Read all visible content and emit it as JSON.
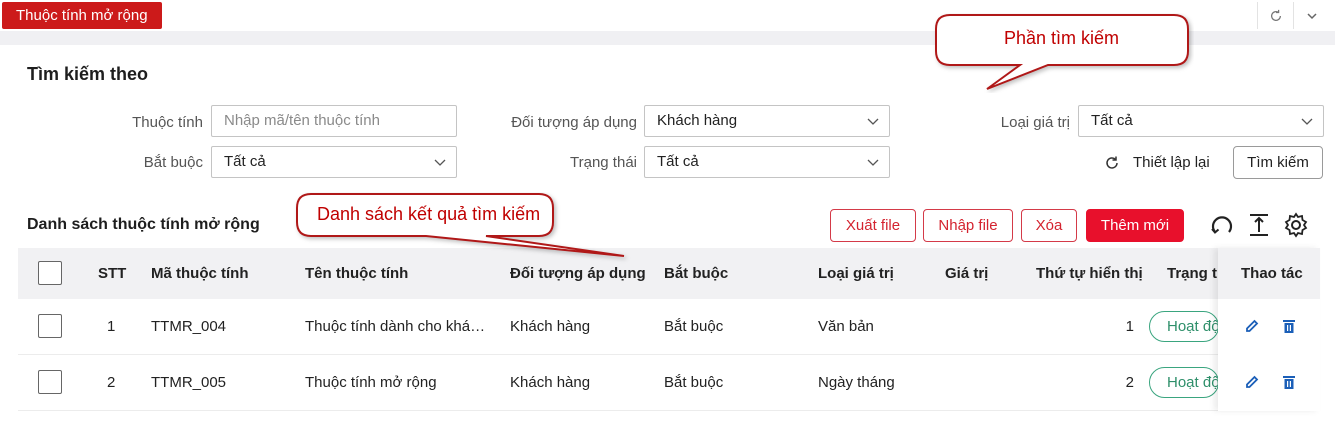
{
  "header": {
    "tab_title": "Thuộc tính mở rộng",
    "actions": [
      {
        "icon": "refresh-icon"
      },
      {
        "icon": "chevron-down-icon"
      }
    ]
  },
  "search": {
    "title": "Tìm kiếm theo",
    "attribute_label": "Thuộc tính",
    "attribute_placeholder": "Nhập mã/tên thuộc tính",
    "target_label": "Đối tượng áp dụng",
    "target_value": "Khách hàng",
    "value_type_label": "Loại giá trị",
    "value_type_value": "Tất cả",
    "required_label": "Bắt buộc",
    "required_value": "Tất cả",
    "status_label": "Trạng thái",
    "status_value": "Tất cả",
    "reset_label": "Thiết lập lại",
    "search_label": "Tìm kiếm"
  },
  "list": {
    "title": "Danh sách thuộc tính mở rộng",
    "export_label": "Xuất file",
    "import_label": "Nhập file",
    "delete_label": "Xóa",
    "add_label": "Thêm mới",
    "columns": [
      "STT",
      "Mã thuộc tính",
      "Tên thuộc tính",
      "Đối tượng áp dụng",
      "Bắt buộc",
      "Loại giá trị",
      "Giá trị",
      "Thứ tự hiển thị",
      "Trạng thái",
      "Thao tác"
    ],
    "rows": [
      {
        "stt": "1",
        "code": "TTMR_004",
        "name": "Thuộc tính dành cho khách hàng",
        "target": "Khách hàng",
        "required": "Bắt buộc",
        "value_type": "Văn bản",
        "value": "",
        "order": "1",
        "status": "Hoạt động"
      },
      {
        "stt": "2",
        "code": "TTMR_005",
        "name": "Thuộc tính mở rộng",
        "target": "Khách hàng",
        "required": "Bắt buộc",
        "value_type": "Ngày tháng",
        "value": "",
        "order": "2",
        "status": "Hoạt động"
      }
    ]
  },
  "annotations": {
    "search_callout": "Phần tìm kiếm",
    "results_callout": "Danh sách kết quả tìm kiếm"
  },
  "colors": {
    "brand_red": "#cc1a1a",
    "primary_red": "#e8102c",
    "status_green": "#3aa57f",
    "callout_red": "#c00000",
    "icon_blue": "#1b5fb8"
  }
}
